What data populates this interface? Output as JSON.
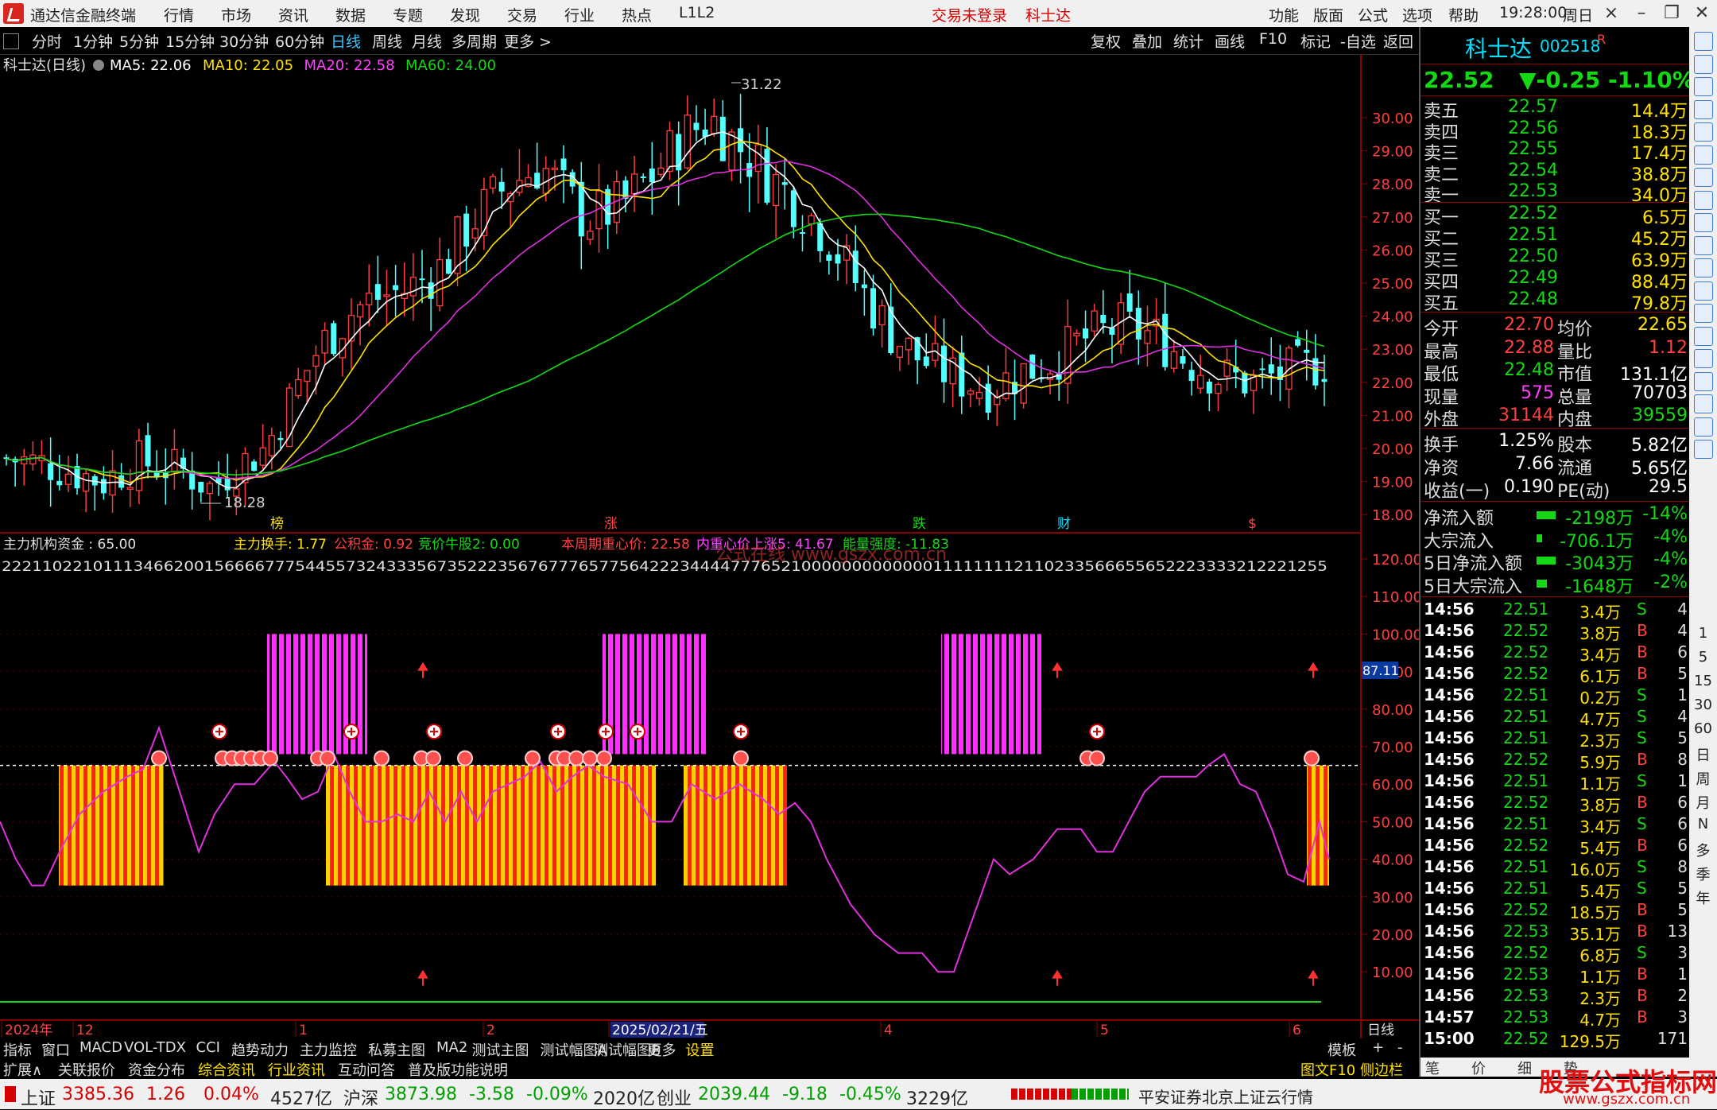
{
  "titlebar": {
    "app_name": "通达信金融终端",
    "menu": [
      "行情",
      "市场",
      "资讯",
      "数据",
      "专题",
      "发现",
      "交易",
      "行业",
      "热点",
      "L1L2"
    ],
    "login_status": "交易未登录",
    "stock_name": "科士达",
    "right_menu": [
      "功能",
      "版面",
      "公式",
      "选项",
      "帮助"
    ],
    "time": "19:28:00",
    "weekday": "周日"
  },
  "toolbar": {
    "periods": [
      "分时",
      "1分钟",
      "5分钟",
      "15分钟",
      "30分钟",
      "60分钟",
      "日线",
      "周线",
      "月线",
      "多周期",
      "更多 >"
    ],
    "active_period": "日线",
    "tools": [
      "复权",
      "叠加",
      "统计",
      "画线",
      "F10",
      "标记",
      "-自选",
      "返回"
    ]
  },
  "main_chart": {
    "header_name": "科士达(日线)",
    "ma_values": [
      {
        "label": "MA5: 22.06",
        "color": "#ffffff"
      },
      {
        "label": "MA10: 22.05",
        "color": "#ffe000"
      },
      {
        "label": "MA20: 22.58",
        "color": "#ff40ff"
      },
      {
        "label": "MA60: 24.00",
        "color": "#14d814"
      }
    ],
    "price_axis": [
      "30.00",
      "29.00",
      "28.00",
      "27.00",
      "26.00",
      "25.00",
      "24.00",
      "23.00",
      "22.00",
      "21.00",
      "20.00",
      "19.00",
      "18.00"
    ],
    "high_label": "31.22",
    "low_label": "18.28",
    "events": [
      "榜",
      "涨",
      "跌",
      "财",
      "$"
    ]
  },
  "indicator": {
    "name": "主力机构资金 : 65.00",
    "params": [
      {
        "text": "主力换手: 1.77",
        "color": "#ffe000"
      },
      {
        "text": "公积金: 0.92",
        "color": "#ff4040"
      },
      {
        "text": "竞价牛股2: 0.00",
        "color": "#14d814"
      },
      {
        "text": "本周期重心价: 22.58",
        "color": "#ff4040"
      },
      {
        "text": "内重心价上涨5: 41.67",
        "color": "#ff40ff"
      },
      {
        "text": "能量强度: -11.83",
        "color": "#14d814"
      }
    ],
    "digits": "22211022101113466200156666777544557324333567352223567677765775642223444477765210000000000000111111112110233566655652223333212221255",
    "axis": [
      "120.00",
      "110.00",
      "100.00",
      "90.00",
      "80.00",
      "70.00",
      "60.00",
      "50.00",
      "40.00",
      "30.00",
      "20.00",
      "10.00"
    ],
    "current_tag": "87.11",
    "watermark": "公式在线 www.gszx.com.cn"
  },
  "date_axis": {
    "labels": [
      "2024年",
      "12",
      "1",
      "2",
      "2025/02/21/五",
      "4",
      "5",
      "6"
    ],
    "right_label": "日线"
  },
  "quote": {
    "name": "科士达",
    "code": "002518",
    "suffix": "R",
    "price": "22.52",
    "change": "▼-0.25",
    "pct": "-1.10%",
    "asks": [
      {
        "label": "卖五",
        "price": "22.57",
        "vol": "14.4万"
      },
      {
        "label": "卖四",
        "price": "22.56",
        "vol": "18.3万"
      },
      {
        "label": "卖三",
        "price": "22.55",
        "vol": "17.4万"
      },
      {
        "label": "卖二",
        "price": "22.54",
        "vol": "38.8万"
      },
      {
        "label": "卖一",
        "price": "22.53",
        "vol": "34.0万"
      }
    ],
    "bids": [
      {
        "label": "买一",
        "price": "22.52",
        "vol": "6.5万"
      },
      {
        "label": "买二",
        "price": "22.51",
        "vol": "45.2万"
      },
      {
        "label": "买三",
        "price": "22.50",
        "vol": "63.9万"
      },
      {
        "label": "买四",
        "price": "22.49",
        "vol": "88.4万"
      },
      {
        "label": "买五",
        "price": "22.48",
        "vol": "79.8万"
      }
    ],
    "stats": [
      {
        "l1": "今开",
        "v1": "22.70",
        "c1": "red",
        "l2": "均价",
        "v2": "22.65",
        "c2": "yel"
      },
      {
        "l1": "最高",
        "v1": "22.88",
        "c1": "red",
        "l2": "量比",
        "v2": "1.12",
        "c2": "red"
      },
      {
        "l1": "最低",
        "v1": "22.48",
        "c1": "grn",
        "l2": "市值",
        "v2": "131.1亿",
        "c2": "wht"
      },
      {
        "l1": "现量",
        "v1": "575",
        "c1": "mag",
        "l2": "总量",
        "v2": "70703",
        "c2": "wht"
      },
      {
        "l1": "外盘",
        "v1": "31144",
        "c1": "red",
        "l2": "内盘",
        "v2": "39559",
        "c2": "grn"
      }
    ],
    "fin": [
      {
        "l1": "换手",
        "v1": "1.25%",
        "l2": "股本",
        "v2": "5.82亿"
      },
      {
        "l1": "净资",
        "v1": "7.66",
        "l2": "流通",
        "v2": "5.65亿"
      },
      {
        "l1": "收益(一)",
        "v1": "0.190",
        "l2": "PE(动)",
        "v2": "29.5"
      }
    ],
    "flows": [
      {
        "label": "净流入额",
        "value": "-2198万",
        "pct": "-14%",
        "bar": 1
      },
      {
        "label": "大宗流入",
        "value": "-706.1万",
        "pct": "-4%",
        "bar": 0.3
      },
      {
        "label": "5日净流入额",
        "value": "-3043万",
        "pct": "-4%",
        "bar": 1
      },
      {
        "label": "5日大宗流入",
        "value": "-1648万",
        "pct": "-2%",
        "bar": 0.55
      }
    ],
    "ticks": [
      {
        "t": "14:56",
        "p": "22.51",
        "v": "3.4万",
        "s": "S",
        "n": "4"
      },
      {
        "t": "14:56",
        "p": "22.52",
        "v": "3.8万",
        "s": "B",
        "n": "4"
      },
      {
        "t": "14:56",
        "p": "22.52",
        "v": "3.4万",
        "s": "B",
        "n": "6"
      },
      {
        "t": "14:56",
        "p": "22.52",
        "v": "6.1万",
        "s": "B",
        "n": "5"
      },
      {
        "t": "14:56",
        "p": "22.51",
        "v": "0.2万",
        "s": "S",
        "n": "1"
      },
      {
        "t": "14:56",
        "p": "22.51",
        "v": "4.7万",
        "s": "S",
        "n": "4"
      },
      {
        "t": "14:56",
        "p": "22.51",
        "v": "2.3万",
        "s": "S",
        "n": "5"
      },
      {
        "t": "14:56",
        "p": "22.52",
        "v": "5.9万",
        "s": "B",
        "n": "8"
      },
      {
        "t": "14:56",
        "p": "22.51",
        "v": "1.1万",
        "s": "S",
        "n": "1"
      },
      {
        "t": "14:56",
        "p": "22.52",
        "v": "3.8万",
        "s": "B",
        "n": "6"
      },
      {
        "t": "14:56",
        "p": "22.51",
        "v": "3.4万",
        "s": "S",
        "n": "6"
      },
      {
        "t": "14:56",
        "p": "22.52",
        "v": "5.4万",
        "s": "B",
        "n": "6"
      },
      {
        "t": "14:56",
        "p": "22.51",
        "v": "16.0万",
        "s": "S",
        "n": "8"
      },
      {
        "t": "14:56",
        "p": "22.51",
        "v": "5.4万",
        "s": "S",
        "n": "5"
      },
      {
        "t": "14:56",
        "p": "22.52",
        "v": "18.5万",
        "s": "B",
        "n": "5"
      },
      {
        "t": "14:56",
        "p": "22.53",
        "v": "35.1万",
        "s": "B",
        "n": "13"
      },
      {
        "t": "14:56",
        "p": "22.52",
        "v": "6.8万",
        "s": "S",
        "n": "3"
      },
      {
        "t": "14:56",
        "p": "22.53",
        "v": "1.1万",
        "s": "B",
        "n": "1"
      },
      {
        "t": "14:56",
        "p": "22.53",
        "v": "2.3万",
        "s": "B",
        "n": "2"
      },
      {
        "t": "14:57",
        "p": "22.53",
        "v": "4.7万",
        "s": "B",
        "n": "3"
      },
      {
        "t": "15:00",
        "p": "22.52",
        "v": "129.5万",
        "s": "",
        "n": "171"
      }
    ],
    "bottom_tabs": [
      "笔",
      "价",
      "细",
      "势"
    ]
  },
  "side_strip": {
    "labels": [
      "1",
      "5",
      "15",
      "30",
      "60",
      "日",
      "周",
      "月",
      "N",
      "多",
      "季",
      "年"
    ]
  },
  "tabs_row1": [
    "指标",
    "窗口",
    "MACD",
    "VOL-TDX",
    "CCI",
    "趋势动力",
    "主力监控",
    "私募主图",
    "MA2",
    "测试主图",
    "测试幅图A",
    "测试幅图B",
    "更多",
    "设置"
  ],
  "tabs_row1_right": [
    "模板",
    "+",
    "-"
  ],
  "tabs_row2": [
    "扩展∧",
    "关联报价",
    "资金分布",
    "综合资讯",
    "行业资讯",
    "互动问答",
    "普及版功能说明"
  ],
  "tabs_row2_right": "图文F10 侧边栏 《",
  "statusbar": {
    "indices": [
      {
        "name": "上证",
        "val": "3385.36",
        "chg": "1.26",
        "pct": "0.04%",
        "amt": "4527亿"
      },
      {
        "name": "沪深",
        "val": "3873.98",
        "chg": "-3.58",
        "pct": "-0.09%",
        "amt": "2020亿"
      },
      {
        "name": "创业",
        "val": "2039.44",
        "chg": "-9.18",
        "pct": "-0.45%",
        "amt": "3229亿"
      }
    ],
    "server": "平安证券北京上证云行情"
  },
  "watermark_brand": "股票公式指标网",
  "watermark_url": "www.gszx.com.cn",
  "colors": {
    "up": "#ff3c3c",
    "down": "#54ffff",
    "ma5": "#ffffff",
    "ma10": "#ffe000",
    "ma20": "#e030e0",
    "ma60": "#14d814"
  }
}
